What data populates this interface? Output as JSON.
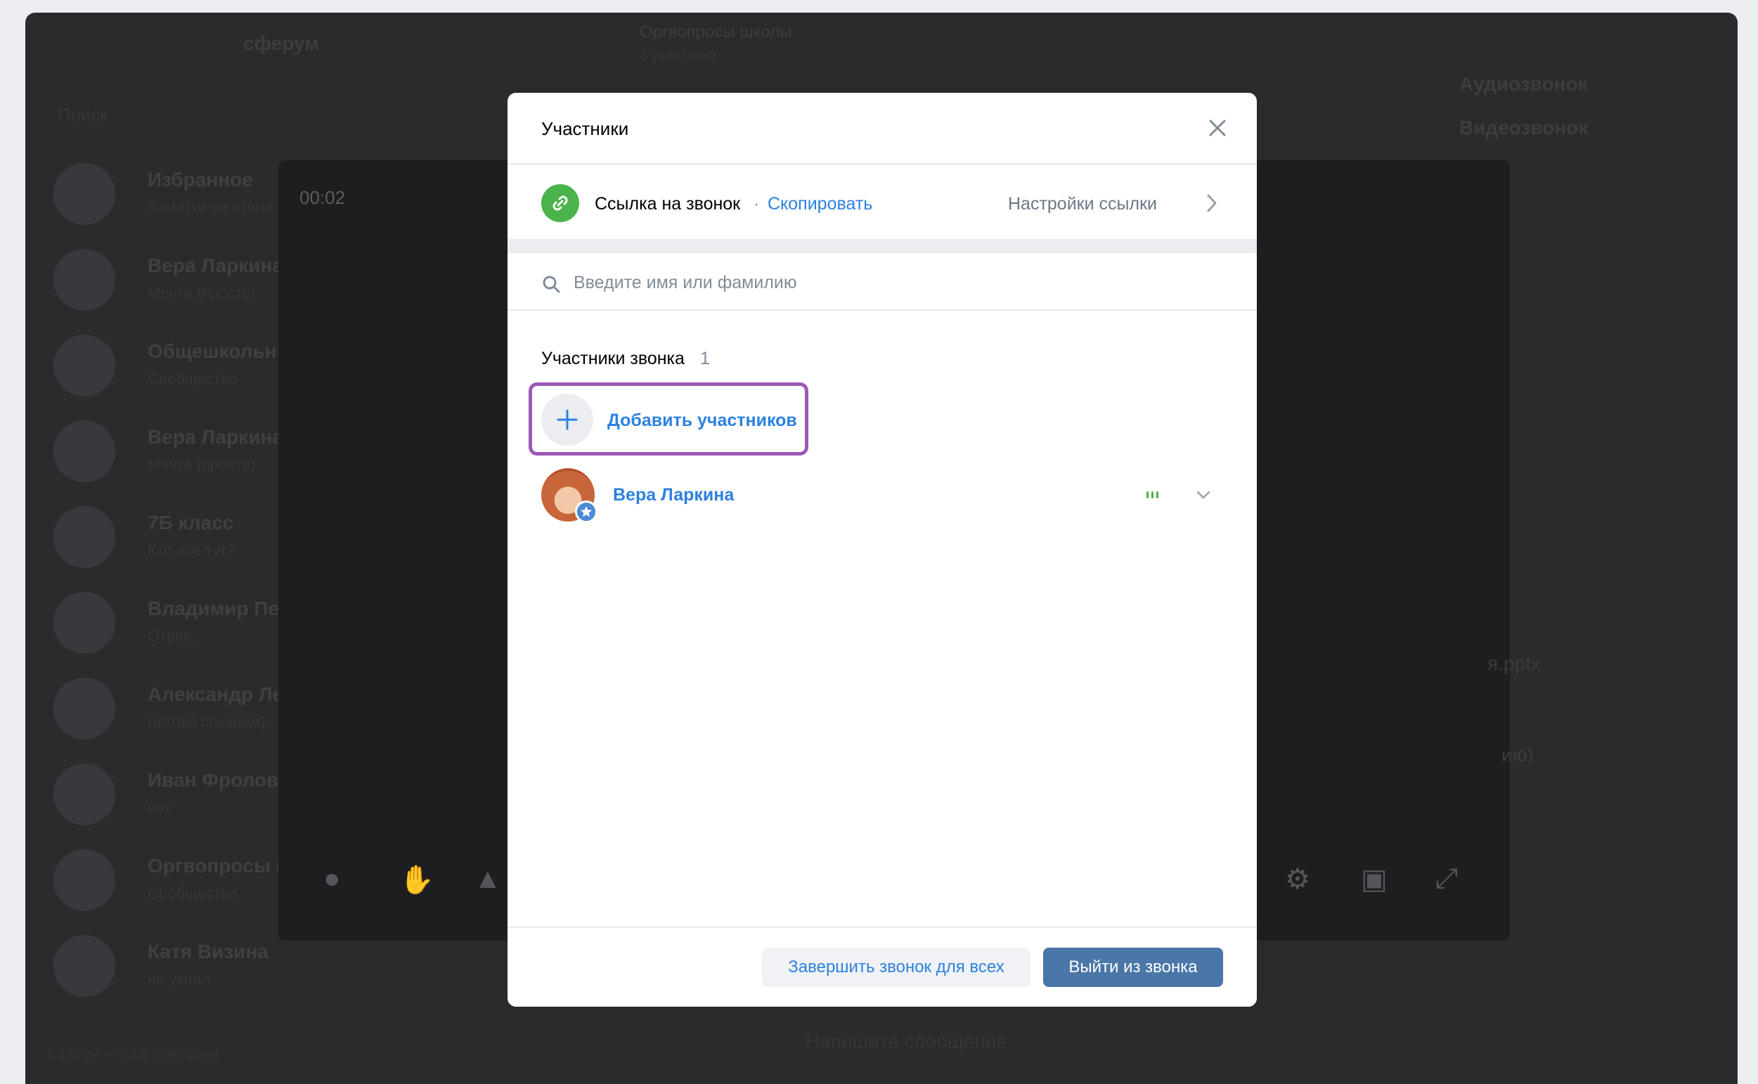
{
  "background": {
    "logo": "сферум",
    "chat_title": "Оргвопросы школы",
    "chat_subtitle": "3 участника",
    "search_placeholder": "Поиск",
    "timer": "00:02",
    "right_audio": "Аудиозвонок",
    "right_video": "Видеозвонок",
    "file_name": "я.pptx",
    "file_note": "ию)",
    "message_placeholder": "Напишите сообщение",
    "footer_text": "Сферум — ваш помощник",
    "chats": [
      {
        "name": "Избранное",
        "msg": "Заметки на стене"
      },
      {
        "name": "Вера Ларкина",
        "msg": "Мечта (просто)"
      },
      {
        "name": "Общешкольный",
        "msg": "Сообщество"
      },
      {
        "name": "Вера Ларкина",
        "msg": "Мечта (просто)"
      },
      {
        "name": "7Б класс",
        "msg": "Кто всё тут?"
      },
      {
        "name": "Владимир Петр",
        "msg": "Ответ..."
      },
      {
        "name": "Александр Лев",
        "msg": "(нотаю слышим)"
      },
      {
        "name": "Иван Фролов",
        "msg": "нет"
      },
      {
        "name": "Оргвопросы ш",
        "msg": "Сообщество"
      },
      {
        "name": "Катя Визина",
        "msg": "не узнал"
      }
    ]
  },
  "modal": {
    "title": "Участники",
    "link": {
      "label": "Ссылка на звонок",
      "separator": "·",
      "copy": "Скопировать",
      "settings": "Настройки ссылки"
    },
    "search": {
      "placeholder": "Введите имя или фамилию"
    },
    "section": {
      "title": "Участники звонка",
      "count": "1"
    },
    "add_button": "Добавить участников",
    "highlight_color": "#9b59b6",
    "members": [
      {
        "name": "Вера Ларкина",
        "role_icon": "star-badge-icon"
      }
    ],
    "footer": {
      "end_for_all": "Завершить звонок для всех",
      "leave": "Выйти из звонка"
    }
  },
  "colors": {
    "accent": "#2d81e0",
    "primary_button": "#4a76a8",
    "link_green": "#4bb34b"
  }
}
